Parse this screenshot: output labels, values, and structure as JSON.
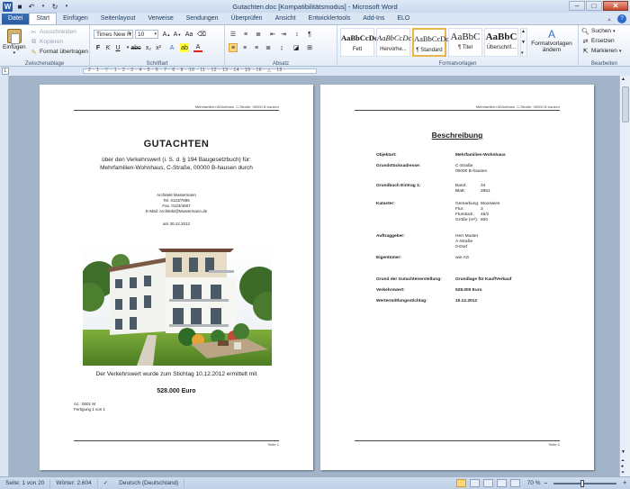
{
  "window": {
    "title": "Gutachten.doc [Kompatibilitätsmodus]  -  Microsoft Word",
    "app_logo": "W"
  },
  "tabs": [
    "Datei",
    "Start",
    "Einfügen",
    "Seitenlayout",
    "Verweise",
    "Sendungen",
    "Überprüfen",
    "Ansicht",
    "Entwicklertools",
    "Add-Ins",
    "ELO"
  ],
  "ribbon": {
    "clipboard": {
      "paste": "Einfügen",
      "cut": "Ausschneiden",
      "copy": "Kopieren",
      "format_painter": "Format übertragen",
      "label": "Zwischenablage"
    },
    "font": {
      "font_name": "Times New R",
      "font_size": "10",
      "label": "Schriftart"
    },
    "paragraph": {
      "label": "Absatz"
    },
    "styles": {
      "items": [
        {
          "sample": "AaBbCcDd",
          "name": "Fett"
        },
        {
          "sample": "AaBbCcDc",
          "name": "Hervorhe..."
        },
        {
          "sample": "AaBbCcDc",
          "name": "¶ Standard"
        },
        {
          "sample": "AaBbC",
          "name": "¶ Titel"
        },
        {
          "sample": "AaBbC",
          "name": "Überschrif..."
        }
      ],
      "change": "Formatvorlagen ändern",
      "label": "Formatvorlagen"
    },
    "editing": {
      "find": "Suchen",
      "replace": "Ersetzen",
      "select": "Markieren",
      "label": "Bearbeiten"
    }
  },
  "ruler": {
    "numbers": "· 2 · 1 · ▽ · 1 · 2 · 3 · 4 · 5 · 6 · 7 · 8 · 9 · 10 · 11 · 12 · 13 · 14 · 15 · 16 · △ · 18 ·"
  },
  "page1": {
    "header": "Mehrfamilien-Wohnhaus, C-Straße, 00000 B-hausen",
    "title": "GUTACHTEN",
    "subtitle_line1": "über den Verkehrswert (i. S. d. § 194 Baugesetzbuch) für:",
    "subtitle_line2": "Mehrfamilien-Wohnhaus, C-Straße, 00000 B-hausen durch",
    "contact": [
      "Architekt Mustermann",
      "Tel. 0123/7896",
      "Fax. 0123/4567",
      "E-Mail: Architekt@Mustermann.de"
    ],
    "date": "am 30.12.2012",
    "value_text": "Der Verkehrswert wurde zum Stichtag 10.12.2012 ermittelt mit",
    "amount": "528.000 Euro",
    "az": "Az.: 0001 M",
    "copy": "Fertigung 1 von 1",
    "footer": "Seite 1"
  },
  "page2": {
    "header": "Mehrfamilien-Wohnhaus, C-Straße, 00000 B-hausen",
    "title": "Beschreibung",
    "objektart_label": "Objektart:",
    "objektart": "Mehrfamilien-Wohnhaus",
    "address_label": "Grundstücksadresse:",
    "address": [
      "C-Straße",
      "00000 B-hausen"
    ],
    "grundbuch_label": "Grundbuch Eintrag 1:",
    "grundbuch": [
      {
        "k": "Band:",
        "v": "34"
      },
      {
        "k": "Blatt:",
        "v": "2861"
      }
    ],
    "kataster_label": "Kataster:",
    "kataster": [
      {
        "k": "Gemarkung:",
        "v": "Mooswies"
      },
      {
        "k": "Flur:",
        "v": "3"
      },
      {
        "k": "Flurstück:",
        "v": "45/2"
      },
      {
        "k": "Größe (m²):",
        "v": "800"
      }
    ],
    "auftraggeber_label": "Auftraggeber:",
    "auftraggeber": [
      "Herr Muster",
      "A-Straße",
      "0-Dorf"
    ],
    "eigentuemer_label": "Eigentümer:",
    "eigentuemer": "wie AG",
    "grund_label": "Grund der Gutachtenerstellung:",
    "grund": "Grundlage für Kauf/Verkauf",
    "verkehrswert_label": "Verkehrswert:",
    "verkehrswert": "528.000 Euro",
    "stichtag_label": "Wertermittlungsstichtag:",
    "stichtag": "10.12.2012",
    "footer": "Seite 2"
  },
  "status": {
    "page": "Seite: 1 von 20",
    "words": "Wörter: 2.604",
    "language": "Deutsch (Deutschland)",
    "zoom": "70 %"
  }
}
